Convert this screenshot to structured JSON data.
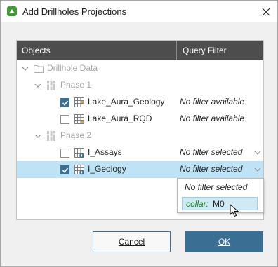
{
  "window": {
    "title": "Add Drillholes Projections"
  },
  "table": {
    "headers": {
      "objects": "Objects",
      "query_filter": "Query Filter"
    },
    "rows": [
      {
        "label": "Drillhole Data",
        "filter": ""
      },
      {
        "label": "Phase 1",
        "filter": ""
      },
      {
        "label": "Lake_Aura_Geology",
        "filter": "No filter available",
        "checked": true
      },
      {
        "label": "Lake_Aura_RQD",
        "filter": "No filter available",
        "checked": false
      },
      {
        "label": "Phase 2",
        "filter": ""
      },
      {
        "label": "I_Assays",
        "filter": "No filter selected",
        "checked": false
      },
      {
        "label": "I_Geology",
        "filter": "No filter selected",
        "checked": true,
        "selected": true
      }
    ]
  },
  "dropdown": {
    "options": [
      {
        "label": "No filter selected"
      },
      {
        "key": "collar:",
        "value": "M0"
      }
    ]
  },
  "buttons": {
    "cancel": "Cancel",
    "ok": "OK"
  },
  "colors": {
    "header_bg": "#4d4d4d",
    "selected_row": "#bfe3f6",
    "accent": "#3a6e92",
    "app_icon": "#3f9c34"
  }
}
